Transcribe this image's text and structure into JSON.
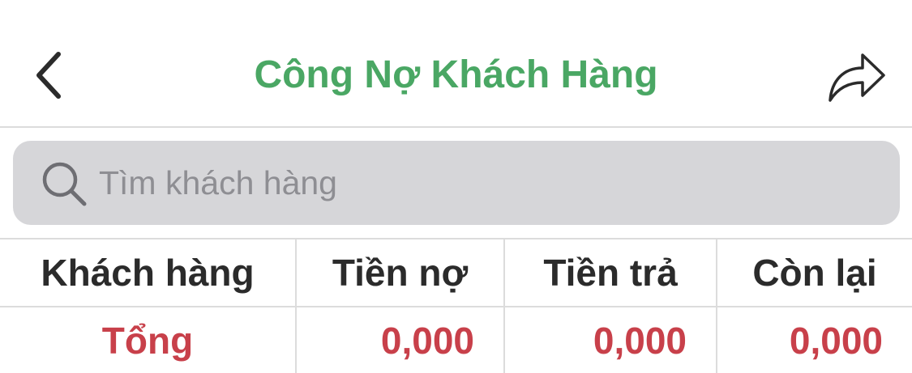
{
  "navbar": {
    "title": "Công Nợ Khách Hàng",
    "back_icon": "chevron-left-icon",
    "share_icon": "share-icon"
  },
  "search": {
    "placeholder": "Tìm khách hàng",
    "value": "",
    "icon": "search-icon"
  },
  "table": {
    "headers": [
      "Khách hàng",
      "Tiền nợ",
      "Tiền trả",
      "Còn lại"
    ],
    "total_row": {
      "label": "Tổng",
      "debt": "0,000",
      "paid": "0,000",
      "remaining": "0,000"
    }
  },
  "colors": {
    "title_green": "#4aa764",
    "total_red": "#c8404a",
    "search_bg": "#d6d6d9",
    "divider": "#dcdcdc"
  }
}
